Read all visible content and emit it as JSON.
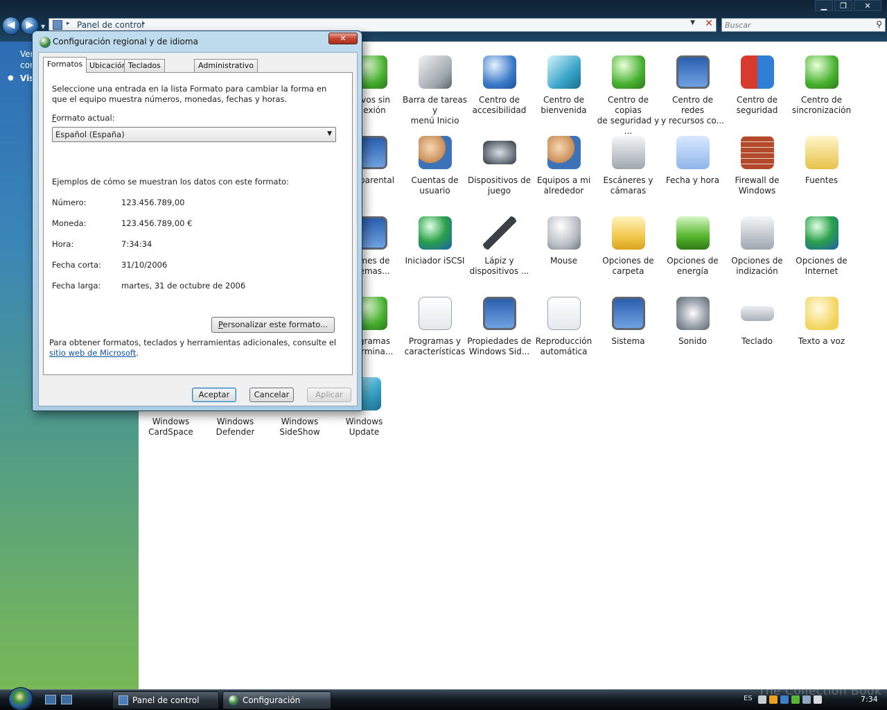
{
  "explorer": {
    "window_controls": {
      "minimize": "▁",
      "maximize": "❐",
      "close": "✕"
    },
    "address": {
      "path": "Panel de control",
      "sep": "▸"
    },
    "search": {
      "placeholder": "Buscar"
    },
    "left_pane": {
      "line1": "Ver",
      "line2": "cor",
      "line3": "Vis"
    }
  },
  "control_panel_items": [
    {
      "label": "…ivos sin\n…exión",
      "icon": "offline-files-icon"
    },
    {
      "label": "Barra de tareas y\nmenú Inicio",
      "icon": "taskbar-icon"
    },
    {
      "label": "Centro de\naccesibilidad",
      "icon": "accessibility-icon"
    },
    {
      "label": "Centro de\nbienvenida",
      "icon": "welcome-icon"
    },
    {
      "label": "Centro de copias\nde seguridad y ...",
      "icon": "backup-icon"
    },
    {
      "label": "Centro de redes\ny recursos co...",
      "icon": "network-icon"
    },
    {
      "label": "Centro de\nseguridad",
      "icon": "security-shield-icon"
    },
    {
      "label": "Centro de\nsincronización",
      "icon": "sync-icon"
    },
    {
      "label": "…l parental",
      "icon": "parental-control-icon"
    },
    {
      "label": "Cuentas de\nusuario",
      "icon": "user-accounts-icon"
    },
    {
      "label": "Dispositivos de\njuego",
      "icon": "gamepad-icon"
    },
    {
      "label": "Equipos a mi\nalrededor",
      "icon": "people-near-me-icon"
    },
    {
      "label": "Escáneres y\ncámaras",
      "icon": "scanner-icon"
    },
    {
      "label": "Fecha y hora",
      "icon": "clock-calendar-icon"
    },
    {
      "label": "Firewall de\nWindows",
      "icon": "firewall-icon"
    },
    {
      "label": "Fuentes",
      "icon": "fonts-folder-icon"
    },
    {
      "label": "…mes de\n…emas...",
      "icon": "problem-reports-icon"
    },
    {
      "label": "Iniciador iSCSI",
      "icon": "iscsi-globe-icon"
    },
    {
      "label": "Lápiz y\ndispositivos ...",
      "icon": "pen-icon"
    },
    {
      "label": "Mouse",
      "icon": "mouse-icon"
    },
    {
      "label": "Opciones de\ncarpeta",
      "icon": "folder-options-icon"
    },
    {
      "label": "Opciones de\nenergía",
      "icon": "power-battery-icon"
    },
    {
      "label": "Opciones de\nindización",
      "icon": "indexing-icon"
    },
    {
      "label": "Opciones de\nInternet",
      "icon": "internet-globe-icon"
    },
    {
      "label": "…gramas\n…ermina...",
      "icon": "default-programs-icon"
    },
    {
      "label": "Programas y\ncaracterísticas",
      "icon": "programs-icon"
    },
    {
      "label": "Propiedades de\nWindows Sid...",
      "icon": "sidebar-monitor-icon"
    },
    {
      "label": "Reproducción\nautomática",
      "icon": "autoplay-icon"
    },
    {
      "label": "Sistema",
      "icon": "system-monitor-icon"
    },
    {
      "label": "Sonido",
      "icon": "speaker-icon"
    },
    {
      "label": "Teclado",
      "icon": "keyboard-icon"
    },
    {
      "label": "Texto a voz",
      "icon": "speech-bubble-icon"
    },
    {
      "label": "Windows\nCardSpace",
      "icon": "cardspace-icon"
    },
    {
      "label": "Windows\nDefender",
      "icon": "defender-icon"
    },
    {
      "label": "Windows\nSideShow",
      "icon": "sideshow-icon"
    },
    {
      "label": "Windows\nUpdate",
      "icon": "windows-update-icon"
    }
  ],
  "dialog": {
    "title": "Configuración regional y de idioma",
    "close_label": "✕",
    "tabs": [
      "Formatos",
      "Ubicación",
      "Teclados e idiomas",
      "Administrativo"
    ],
    "intro": "Seleccione una entrada en la lista Formato para cambiar la forma en que el equipo muestra números, monedas, fechas y horas.",
    "format_label_accel": "F",
    "format_label_rest": "ormato actual:",
    "format_value": "Español (España)",
    "examples_heading": "Ejemplos de cómo se muestran los datos con este formato:",
    "examples": [
      {
        "label": "Número:",
        "value": "123.456.789,00"
      },
      {
        "label": "Moneda:",
        "value": "123.456.789,00 €"
      },
      {
        "label": "Hora:",
        "value": "7:34:34"
      },
      {
        "label": "Fecha corta:",
        "value": "31/10/2006"
      },
      {
        "label": "Fecha larga:",
        "value": "martes, 31 de octubre de 2006"
      }
    ],
    "customize_accel": "P",
    "customize_rest": "ersonalizar este formato...",
    "footer_text": "Para obtener formatos, teclados y herramientas adicionales, consulte el ",
    "footer_link": "sitio web de Microsoft",
    "footer_end": ".",
    "buttons": {
      "ok": "Aceptar",
      "cancel": "Cancelar",
      "apply": "Aplicar"
    }
  },
  "taskbar": {
    "buttons": [
      "Panel de control",
      "Configuración regio..."
    ],
    "watermark": "The Collection Book",
    "language": "ES",
    "clock": "7:34"
  }
}
